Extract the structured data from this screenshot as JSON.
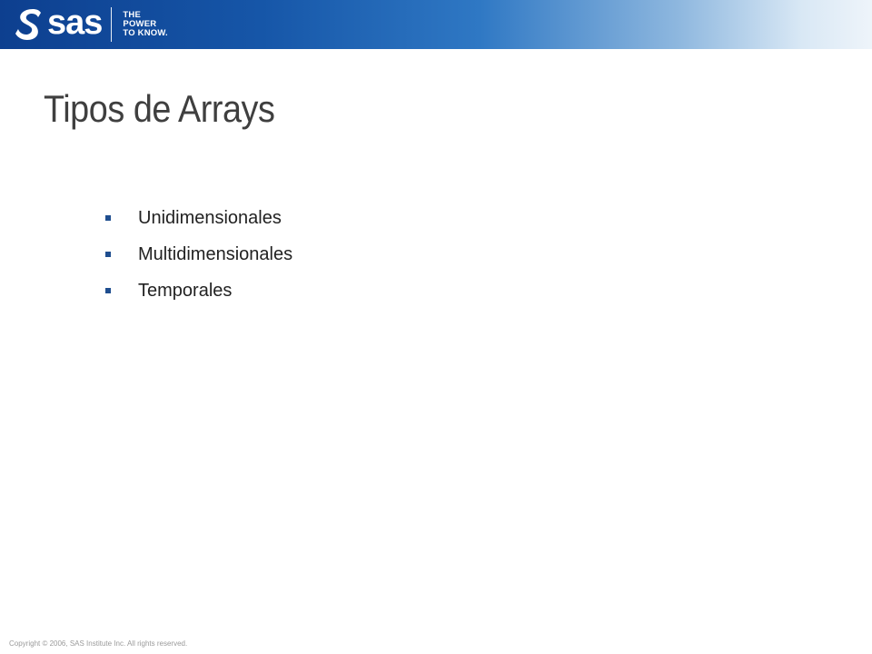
{
  "header": {
    "logo_text": "sas",
    "tagline_line1": "THE",
    "tagline_line2": "POWER",
    "tagline_line3": "TO KNOW."
  },
  "slide": {
    "title": "Tipos de Arrays",
    "bullets": [
      "Unidimensionales",
      "Multidimensionales",
      "Temporales"
    ]
  },
  "footer": {
    "copyright": "Copyright © 2006,  SAS Institute Inc.  All rights reserved."
  },
  "colors": {
    "header_dark": "#0d3f8f",
    "header_light": "#eef4fa",
    "title": "#3f3f3f",
    "bullet_marker": "#1f4e8f"
  }
}
